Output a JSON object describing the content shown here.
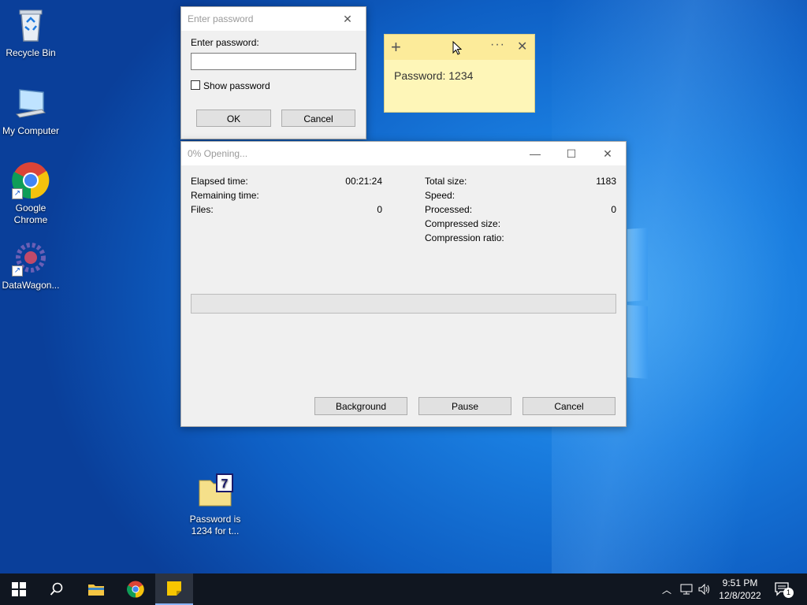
{
  "desktop": {
    "icons": [
      {
        "label": "Recycle Bin"
      },
      {
        "label": "My Computer"
      },
      {
        "label": "Google Chrome"
      },
      {
        "label": "DataWagon..."
      },
      {
        "label": "Password is 1234 for t..."
      }
    ]
  },
  "password_dialog": {
    "title": "Enter password",
    "prompt": "Enter password:",
    "input_value": "",
    "show_password_label": "Show password",
    "show_password_checked": false,
    "ok_label": "OK",
    "cancel_label": "Cancel"
  },
  "sticky_note": {
    "text": "Password: 1234",
    "add_icon": "plus-icon",
    "menu_icon": "more-icon",
    "close_icon": "close-icon"
  },
  "progress_window": {
    "title": "0% Opening...",
    "left": [
      {
        "label": "Elapsed time:",
        "value": "00:21:24"
      },
      {
        "label": "Remaining time:",
        "value": ""
      },
      {
        "label": "Files:",
        "value": "0"
      }
    ],
    "right": [
      {
        "label": "Total size:",
        "value": "1183"
      },
      {
        "label": "Speed:",
        "value": ""
      },
      {
        "label": "Processed:",
        "value": "0"
      },
      {
        "label": "Compressed size:",
        "value": ""
      },
      {
        "label": "Compression ratio:",
        "value": ""
      }
    ],
    "progress_percent": 0,
    "background_label": "Background",
    "pause_label": "Pause",
    "cancel_label": "Cancel"
  },
  "taskbar": {
    "items": [
      "start-icon",
      "search-icon",
      "file-explorer-icon",
      "chrome-icon",
      "sticky-notes-icon"
    ],
    "time": "9:51 PM",
    "date": "12/8/2022",
    "notification_count": "1"
  },
  "colors": {
    "accent": "#0078d7",
    "sticky": "#fef6b8",
    "taskbar": "#101620"
  }
}
